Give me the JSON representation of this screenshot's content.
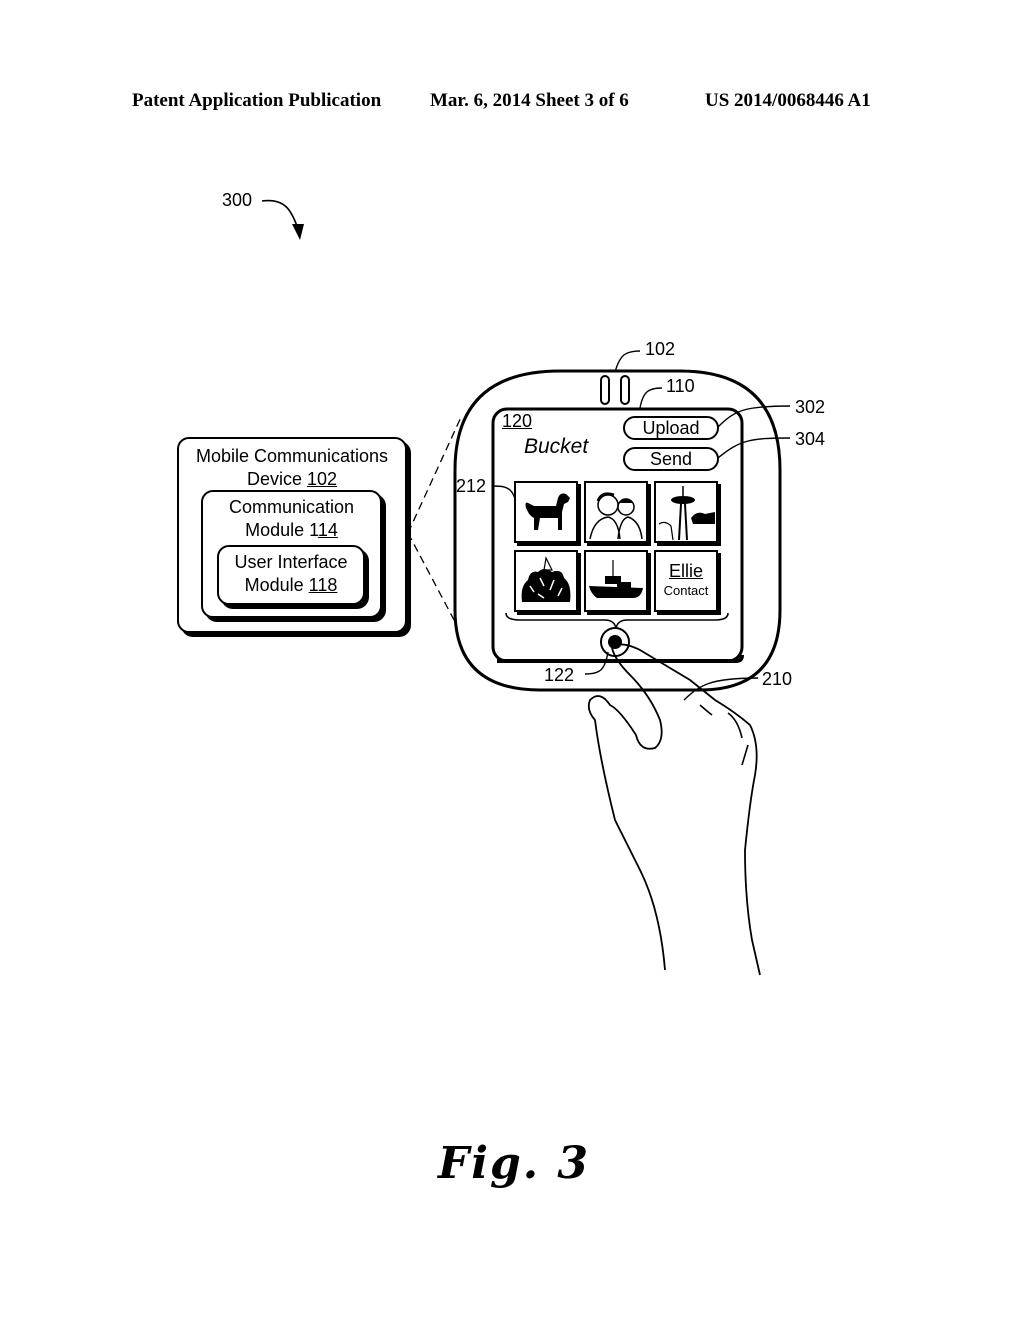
{
  "header": {
    "left": "Patent Application Publication",
    "date_sheet": "Mar. 6, 2014   Sheet 3 of 6",
    "number": "US 2014/0068446 A1"
  },
  "figure": {
    "ref": "300",
    "caption": "Fig. 3"
  },
  "block_diagram": {
    "outer": {
      "line1": "Mobile Communications",
      "line2": "Device ",
      "ref": "102"
    },
    "middle": {
      "line1": "Communication",
      "line2": "Module 1",
      "ref": "14"
    },
    "inner": {
      "line1": "User Interface",
      "line2": "Module ",
      "ref": "118"
    }
  },
  "device": {
    "ref_device": "102",
    "ref_display": "110",
    "ref_ui": "120",
    "title": "Bucket",
    "upload_button": "Upload",
    "send_button": "Send",
    "ref_upload": "302",
    "ref_send": "304",
    "ref_items": "212",
    "ref_button": "122",
    "ref_finger": "210",
    "tiles": [
      {
        "icon": "dog-image"
      },
      {
        "icon": "people-image"
      },
      {
        "icon": "space-needle-image"
      },
      {
        "icon": "trees-image"
      },
      {
        "icon": "boat-image"
      },
      {
        "icon": "contact",
        "name": "Ellie",
        "label": "Contact"
      }
    ]
  }
}
